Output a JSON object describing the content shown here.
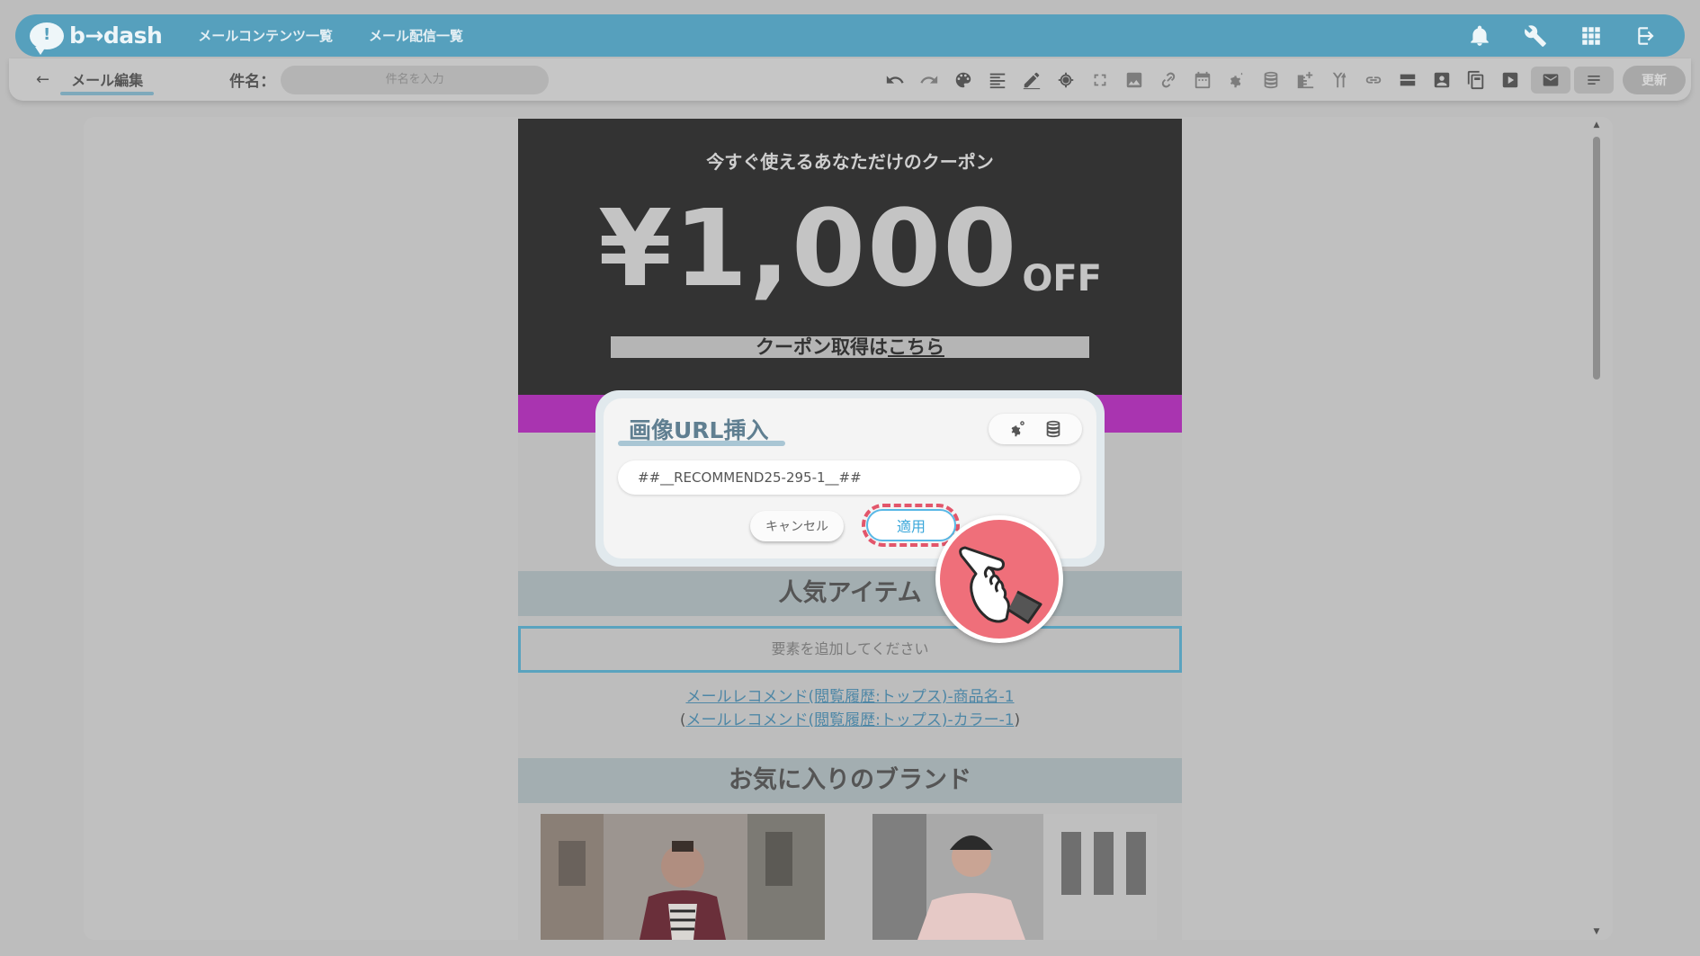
{
  "header": {
    "logo_mark": "!",
    "logo_text": "b→dash",
    "nav": [
      "メールコンテンツ一覧",
      "メール配信一覧"
    ],
    "icons": [
      "bell-icon",
      "wrench-icon",
      "grid-icon",
      "logout-icon"
    ],
    "bg_color": "#56a0bd"
  },
  "toolbar": {
    "back_icon": "←",
    "breadcrumb": "メール編集",
    "subject_label": "件名：",
    "subject_placeholder": "件名を入力",
    "update_label": "更新",
    "icons": [
      "undo-icon",
      "redo-icon",
      "palette-icon",
      "align-icon",
      "edit-icon",
      "target-icon",
      "fullscreen-icon",
      "image-icon",
      "link-icon",
      "calendar-icon",
      "gears-icon",
      "database-icon",
      "insert-icon",
      "branch-icon",
      "link-chain-icon",
      "layout-icon",
      "profile-icon",
      "copy-icon",
      "play-icon",
      "mail-icon",
      "list-icon"
    ]
  },
  "email": {
    "coupon_lead": "今すぐ使えるあなただけのクーポン",
    "coupon_amount": "¥1,000",
    "coupon_off": "OFF",
    "coupon_link_prefix": "クーポン取得は",
    "coupon_link_text": "こちら",
    "popular_heading": "人気アイテム",
    "dropzone_text": "要素を追加してください",
    "rec_link_1": "メールレコメンド(閲覧履歴:トップス)-商品名-1",
    "rec_open": "(",
    "rec_link_2": "メールレコメンド(閲覧履歴:トップス)-カラー-1",
    "rec_close": ")",
    "brand_heading": "お気に入りのブランド",
    "colors": {
      "coupon_bg": "#333333",
      "band": "#a934b0",
      "section": "#a3aeb1"
    }
  },
  "modal": {
    "title": "画像URL挿入",
    "url_value": "##__RECOMMEND25-295-1__##",
    "cancel_label": "キャンセル",
    "apply_label": "適用",
    "icons": [
      "gears-icon",
      "database-icon"
    ],
    "highlight_color": "#e2566b"
  }
}
